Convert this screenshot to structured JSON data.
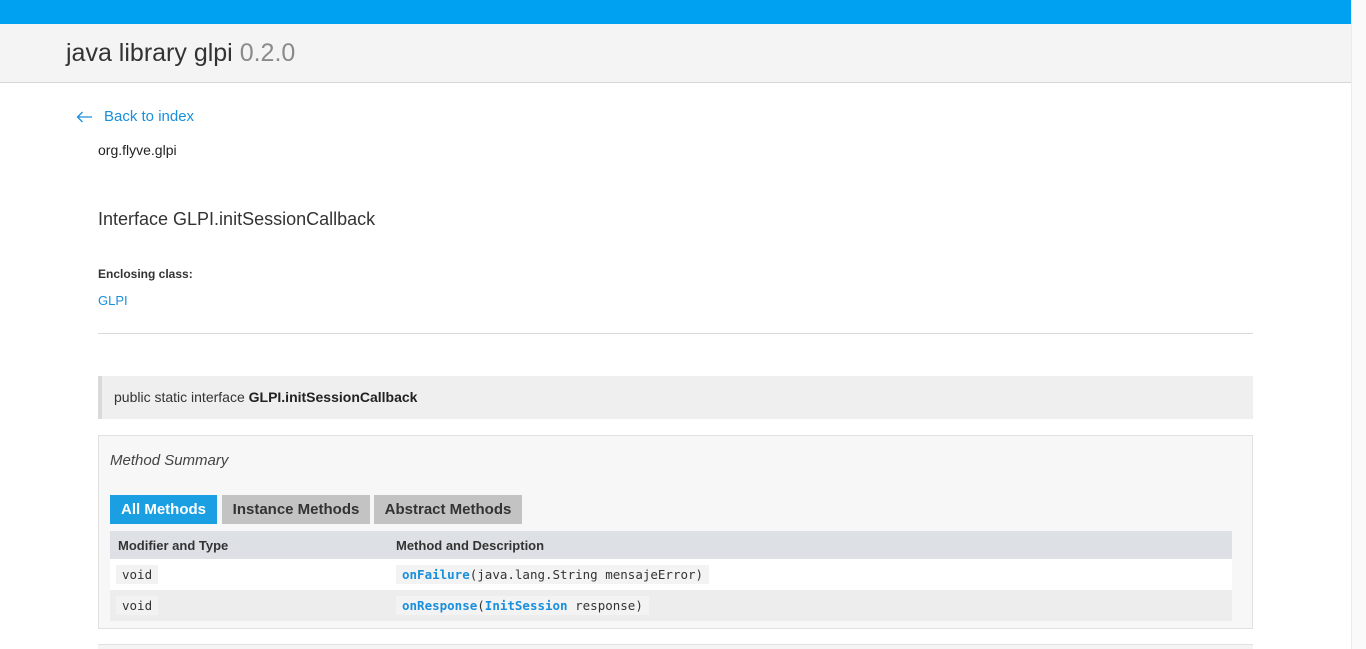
{
  "header": {
    "title": "java library glpi",
    "version": "0.2.0"
  },
  "nav": {
    "back_label": "Back to index"
  },
  "package": "org.flyve.glpi",
  "interface_title": "Interface GLPI.initSessionCallback",
  "enclosing": {
    "label": "Enclosing class:",
    "class_name": "GLPI"
  },
  "signature": {
    "prefix": "public static interface",
    "name": "GLPI.initSessionCallback"
  },
  "method_summary": {
    "title": "Method Summary",
    "tabs": [
      {
        "label": "All Methods",
        "active": true
      },
      {
        "label": "Instance Methods",
        "active": false
      },
      {
        "label": "Abstract Methods",
        "active": false
      }
    ],
    "columns": [
      "Modifier and Type",
      "Method and Description"
    ],
    "rows": [
      {
        "type": "void",
        "method": "onFailure",
        "param_type": "java.lang.String",
        "param_type_link": false,
        "param_name": "mensajeError"
      },
      {
        "type": "void",
        "method": "onResponse",
        "param_type": "InitSession",
        "param_type_link": true,
        "param_name": "response"
      }
    ]
  },
  "colors": {
    "accent": "#00a1f1",
    "link": "#1a8fdc",
    "tab_active": "#1a9fe3",
    "tab_inactive": "#c3c3c3"
  },
  "icons": {
    "back": "arrow-left-icon"
  }
}
